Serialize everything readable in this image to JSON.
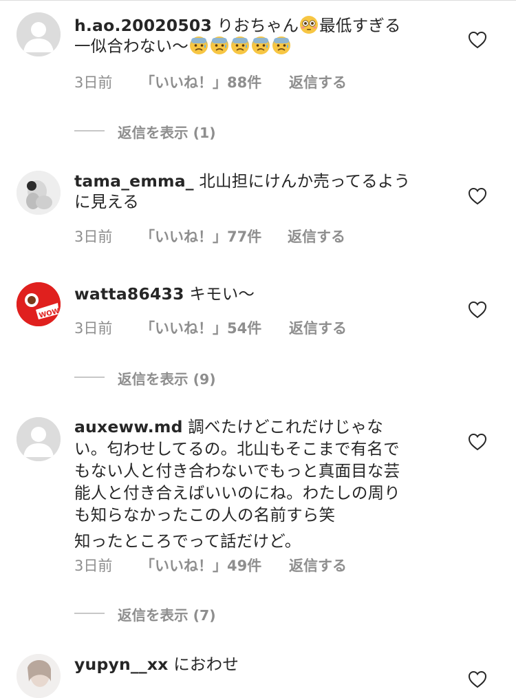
{
  "colors": {
    "text": "#262626",
    "secondary": "#8e8e8e",
    "divider": "#dbdbdb",
    "avatar_placeholder": "#e5e5e5"
  },
  "comments": [
    {
      "username": "h.ao.20020503",
      "text": " りおちゃん",
      "text_after_emoji": "最低すぎる",
      "line2": "一似合わない〜",
      "emojis_inline": [
        "flushed-face-emoji"
      ],
      "emojis_trailing": [
        "anxious-sweat-face-emoji",
        "anxious-sweat-face-emoji",
        "anxious-sweat-face-emoji",
        "anxious-sweat-face-emoji",
        "anxious-sweat-face-emoji"
      ],
      "time": "3日前",
      "likes": "「いいね！」88件",
      "reply": "返信する",
      "view_replies": "返信を表示 (1)",
      "avatar": "default-avatar"
    },
    {
      "username": "tama_emma_",
      "text": " 北山担にけんか売ってるよう",
      "line2": "に見える",
      "time": "3日前",
      "likes": "「いいね！」77件",
      "reply": "返信する",
      "avatar": "photo-avatar"
    },
    {
      "username": "watta86433",
      "text": " キモい〜",
      "time": "3日前",
      "likes": "「いいね！」54件",
      "reply": "返信する",
      "view_replies": "返信を表示 (9)",
      "avatar": "red-wow-avatar"
    },
    {
      "username": "auxeww.md",
      "text": " 調べたけどこれだけじゃな",
      "lines": [
        "い。匂わせしてるの。北山もそこまで有名で",
        "もない人と付き合わないでもっと真面目な芸",
        "能人と付き合えばいいのにね。わたしの周り",
        "も知らなかったこの人の名前すら笑",
        "知ったところでって話だけど。"
      ],
      "time": "3日前",
      "likes": "「いいね！」49件",
      "reply": "返信する",
      "view_replies": "返信を表示 (7)",
      "avatar": "default-avatar"
    },
    {
      "username": "yupyn__xx",
      "text": " におわせ",
      "avatar": "photo-avatar"
    }
  ]
}
